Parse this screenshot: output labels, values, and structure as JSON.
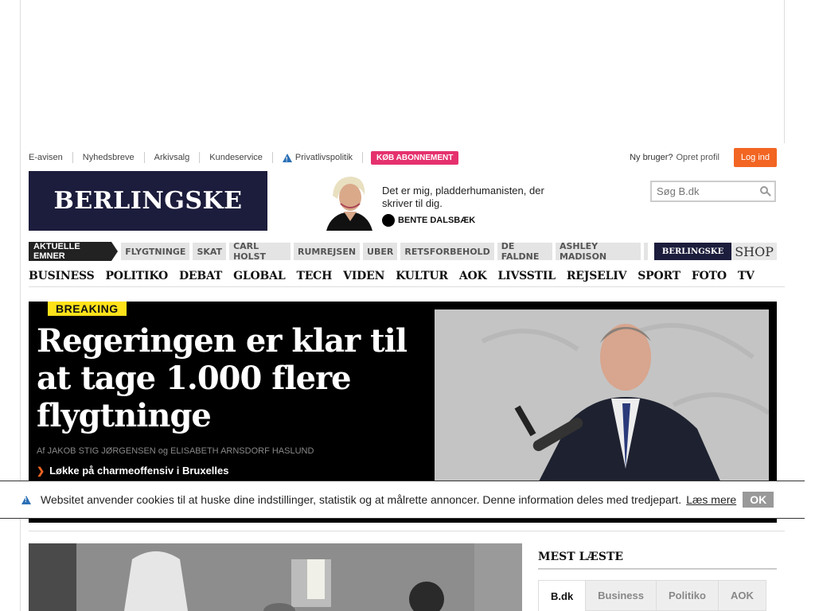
{
  "utility": {
    "links": [
      "E-avisen",
      "Nyhedsbreve",
      "Arkivsalg",
      "Kundeservice"
    ],
    "privacy": "Privatlivspolitik",
    "subscribe": "KØB ABONNEMENT",
    "new_user": "Ny bruger?",
    "create_profile": "Opret profil",
    "login": "Log ind"
  },
  "masthead": {
    "logo": "BERLINGSKE",
    "columnist_quote": "Det er mig, pladderhumanisten, der skriver til dig.",
    "columnist_name": "BENTE DALSBÆK"
  },
  "search": {
    "placeholder": "Søg B.dk"
  },
  "topics": {
    "label": "AKTUELLE EMNER",
    "items": [
      "FLYGTNINGE",
      "SKAT",
      "CARL HOLST",
      "RUMREJSEN",
      "UBER",
      "RETSFORBEHOLD",
      "DE FALDNE",
      "ASHLEY MADISON"
    ],
    "shop_brand": "BERLINGSKE",
    "shop_label": "SHOP"
  },
  "sections": [
    "BUSINESS",
    "POLITIKO",
    "DEBAT",
    "GLOBAL",
    "TECH",
    "VIDEN",
    "KULTUR",
    "AOK",
    "LIVSSTIL",
    "REJSELIV",
    "SPORT",
    "FOTO",
    "TV"
  ],
  "hero": {
    "badge": "BREAKING",
    "headline": "Regeringen er klar til at tage 1.000 flere flygtninge",
    "authors": "Af JAKOB STIG JØRGENSEN og ELISABETH ARNSDORF HASLUND",
    "related": "Løkke på charmeoffensiv i Bruxelles"
  },
  "cookie": {
    "text": "Websitet anvender cookies til at huske dine indstillinger, statistik og at målrette annoncer. Denne information deles med tredjepart.",
    "more": "Læs mere",
    "ok": "OK"
  },
  "most_read": {
    "title": "MEST LÆSTE",
    "tabs": [
      "B.dk",
      "Business",
      "Politiko",
      "AOK"
    ]
  },
  "colors": {
    "brand_navy": "#1c1c3c",
    "subscribe_pink": "#e5316d",
    "login_orange": "#f26522",
    "breaking_yellow": "#ffe21a"
  }
}
